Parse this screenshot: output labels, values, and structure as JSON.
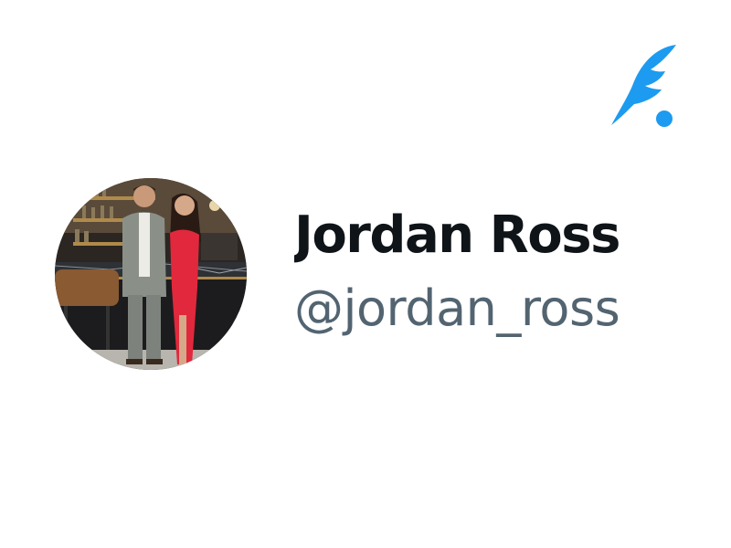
{
  "app": {
    "logo_icon": "quill-feather-icon",
    "accent_color": "#1d9bf0"
  },
  "profile": {
    "display_name": "Jordan Ross",
    "handle": "@jordan_ross",
    "avatar_icon": "profile-photo"
  },
  "colors": {
    "name_text": "#0f1419",
    "handle_text": "#536471",
    "background": "#ffffff"
  }
}
